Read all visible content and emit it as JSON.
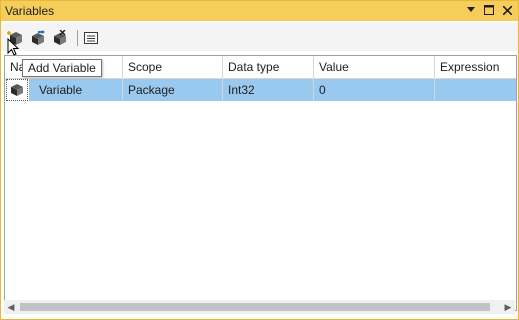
{
  "window": {
    "title": "Variables",
    "controls": {
      "pin_icon": "dropdown-triangle",
      "maximize_icon": "square",
      "close_icon": "x"
    }
  },
  "toolbar": {
    "buttons": [
      {
        "name": "add-variable-button",
        "icon": "add-variable-icon"
      },
      {
        "name": "move-variable-button",
        "icon": "move-variable-icon"
      },
      {
        "name": "delete-variable-button",
        "icon": "delete-variable-icon"
      },
      {
        "name": "grid-options-button",
        "icon": "grid-options-icon"
      }
    ],
    "tooltip": "Add Variable"
  },
  "grid": {
    "columns": [
      "Na",
      "Scope",
      "Data type",
      "Value",
      "Expression"
    ],
    "rows": [
      {
        "name": "Variable",
        "scope": "Package",
        "data_type": "Int32",
        "value": "0",
        "expression": ""
      }
    ],
    "selection_color": "#99c9ef"
  },
  "colors": {
    "titlebar": "#f5cd5a",
    "accent_border": "#e8b838"
  }
}
